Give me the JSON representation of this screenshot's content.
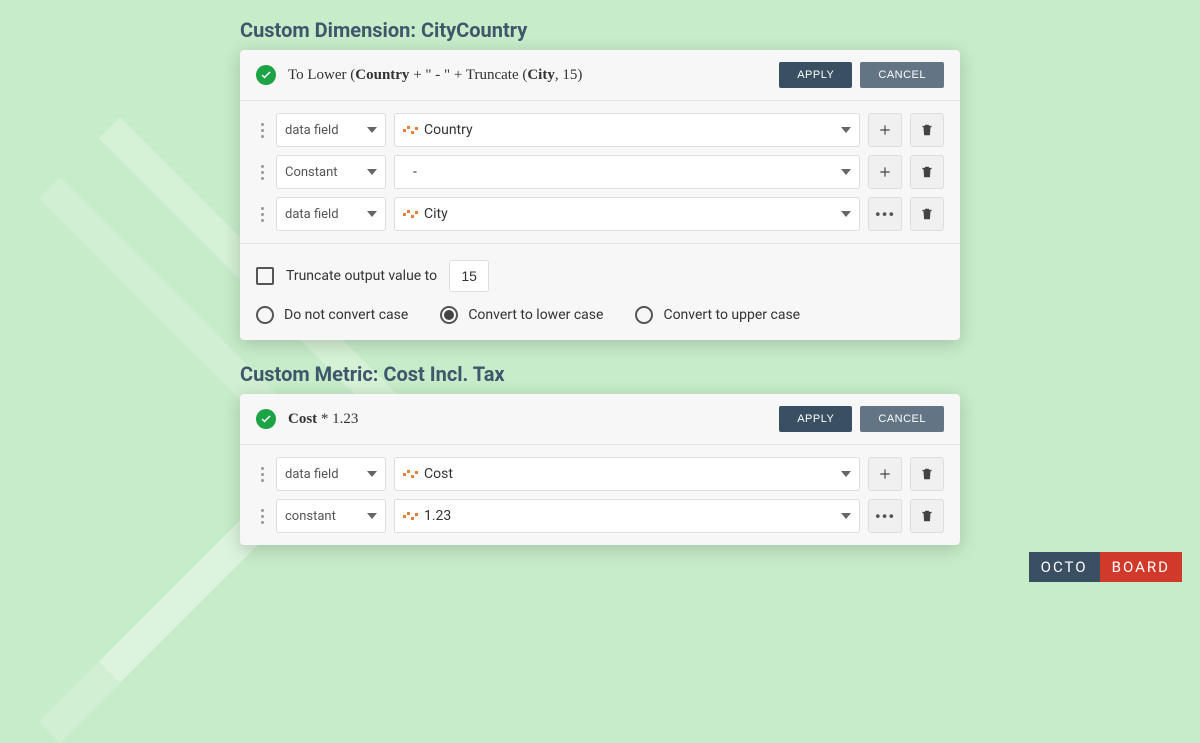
{
  "section1": {
    "title": "Custom Dimension: CityCountry",
    "formula_prefix": "To Lower (",
    "formula_field1": "Country",
    "formula_mid1": " + \" - \" + Truncate (",
    "formula_field2": "City",
    "formula_mid2": ", 15)",
    "apply": "APPLY",
    "cancel": "CANCEL",
    "rows": [
      {
        "type": "data field",
        "value": "Country",
        "has_icon": true
      },
      {
        "type": "Constant",
        "value": "-",
        "has_icon": false
      },
      {
        "type": "data field",
        "value": "City",
        "has_icon": true
      }
    ],
    "truncate_label": "Truncate output value to",
    "truncate_value": "15",
    "radio_no_convert": "Do not convert case",
    "radio_lower": "Convert to lower case",
    "radio_upper": "Convert to upper case"
  },
  "section2": {
    "title": "Custom Metric: Cost Incl. Tax",
    "formula_field1": "Cost",
    "formula_mid1": " * 1.23",
    "apply": "APPLY",
    "cancel": "CANCEL",
    "rows": [
      {
        "type": "data field",
        "value": "Cost"
      },
      {
        "type": "constant",
        "value": "1.23"
      }
    ]
  },
  "brand": {
    "left": "OCTO",
    "right": "BOARD"
  }
}
